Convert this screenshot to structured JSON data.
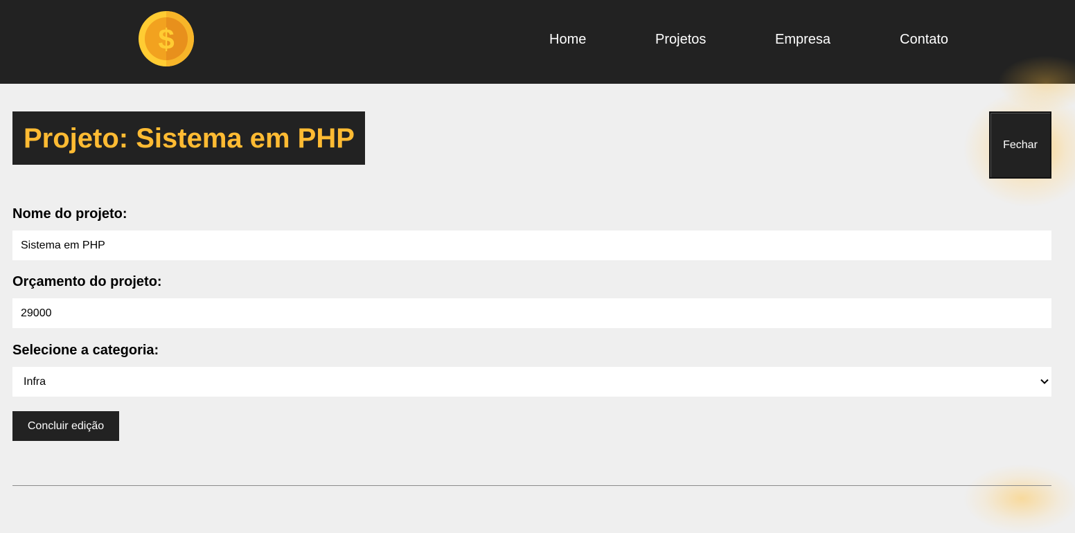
{
  "navbar": {
    "logo_icon": "dollar-coin-icon",
    "items": [
      {
        "label": "Home"
      },
      {
        "label": "Projetos"
      },
      {
        "label": "Empresa"
      },
      {
        "label": "Contato"
      }
    ]
  },
  "project": {
    "title": "Projeto: Sistema em PHP",
    "close_label": "Fechar"
  },
  "form": {
    "name_label": "Nome do projeto:",
    "name_value": "Sistema em PHP",
    "budget_label": "Orçamento do projeto:",
    "budget_value": "29000",
    "category_label": "Selecione a categoria:",
    "category_value": "Infra",
    "submit_label": "Concluir edição"
  },
  "colors": {
    "navbar_bg": "#222222",
    "accent": "#ffbb33",
    "page_bg": "#efefef"
  }
}
